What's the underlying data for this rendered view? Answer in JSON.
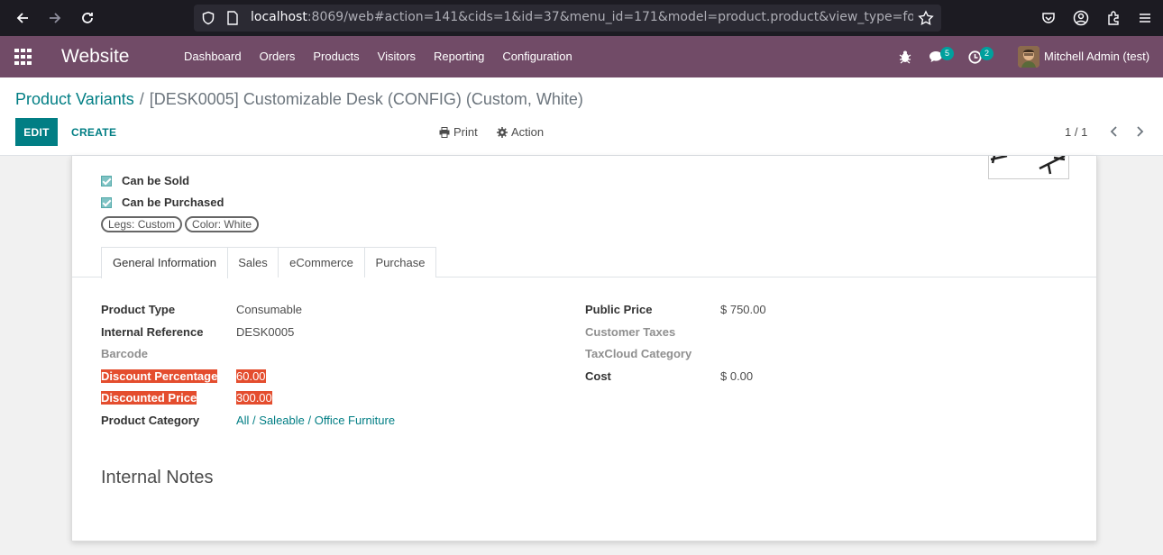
{
  "browser": {
    "url_host": "localhost",
    "url_rest": ":8069/web#action=141&cids=1&id=37&menu_id=171&model=product.product&view_type=form"
  },
  "navbar": {
    "brand": "Website",
    "menu": [
      "Dashboard",
      "Orders",
      "Products",
      "Visitors",
      "Reporting",
      "Configuration"
    ],
    "messages_count": "5",
    "activities_count": "2",
    "user_name": "Mitchell Admin (test)"
  },
  "control_panel": {
    "breadcrumb_parent": "Product Variants",
    "breadcrumb_sep": "/",
    "breadcrumb_current": "[DESK0005] Customizable Desk (CONFIG) (Custom, White)",
    "edit_label": "EDIT",
    "create_label": "CREATE",
    "print_label": "Print",
    "action_label": "Action",
    "pager": "1 / 1"
  },
  "form": {
    "can_be_sold": "Can be Sold",
    "can_be_purchased": "Can be Purchased",
    "tags": [
      "Legs: Custom",
      "Color: White"
    ],
    "tabs": [
      "General Information",
      "Sales",
      "eCommerce",
      "Purchase"
    ],
    "left_fields": {
      "product_type_label": "Product Type",
      "product_type_value": "Consumable",
      "internal_ref_label": "Internal Reference",
      "internal_ref_value": "DESK0005",
      "barcode_label": "Barcode",
      "discount_pct_label": "Discount Percentage",
      "discount_pct_value": "60.00",
      "discounted_price_label": "Discounted Price",
      "discounted_price_value": "300.00",
      "category_label": "Product Category",
      "category_value": "All / Saleable / Office Furniture"
    },
    "right_fields": {
      "public_price_label": "Public Price",
      "public_price_value": "$ 750.00",
      "customer_taxes_label": "Customer Taxes",
      "taxcloud_label": "TaxCloud Category",
      "cost_label": "Cost",
      "cost_value": "$ 0.00"
    },
    "internal_notes_title": "Internal Notes"
  },
  "colors": {
    "navbar": "#714b67",
    "primary": "#017e84",
    "highlight": "#e44d2e"
  }
}
